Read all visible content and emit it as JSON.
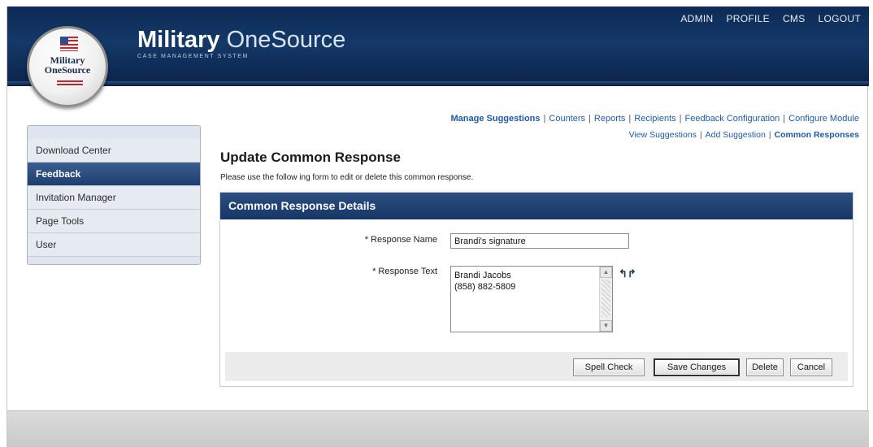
{
  "brand": {
    "name_bold": "Military",
    "name_light": " OneSource",
    "subtitle": "CASE MANAGEMENT SYSTEM",
    "seal_line1": "Military",
    "seal_line2": "OneSource"
  },
  "topnav": [
    "ADMIN",
    "PROFILE",
    "CMS",
    "LOGOUT"
  ],
  "sidebar": {
    "items": [
      {
        "label": "Download Center",
        "active": false
      },
      {
        "label": "Feedback",
        "active": true
      },
      {
        "label": "Invitation Manager",
        "active": false
      },
      {
        "label": "Page Tools",
        "active": false
      },
      {
        "label": "User",
        "active": false
      }
    ]
  },
  "subnav": {
    "primary": [
      "Manage Suggestions",
      "Counters",
      "Reports",
      "Recipients",
      "Feedback Configuration",
      "Configure Module"
    ],
    "secondary": [
      "View Suggestions",
      "Add Suggestion",
      "Common Responses"
    ]
  },
  "page": {
    "title": "Update Common Response",
    "description": "Please use the follow ing form to edit or delete this common response."
  },
  "panel": {
    "title": "Common Response Details",
    "name_label": "* Response Name",
    "name_value": "Brandi's signature",
    "text_label": "* Response Text",
    "text_value": "Brandi Jacobs\n(858) 882-5809"
  },
  "buttons": {
    "spell_check": "Spell Check",
    "save": "Save Changes",
    "delete": "Delete",
    "cancel": "Cancel"
  },
  "colors": {
    "header": "#143968",
    "link": "#1f5aa6",
    "active_nav": "#1d3f6e"
  }
}
